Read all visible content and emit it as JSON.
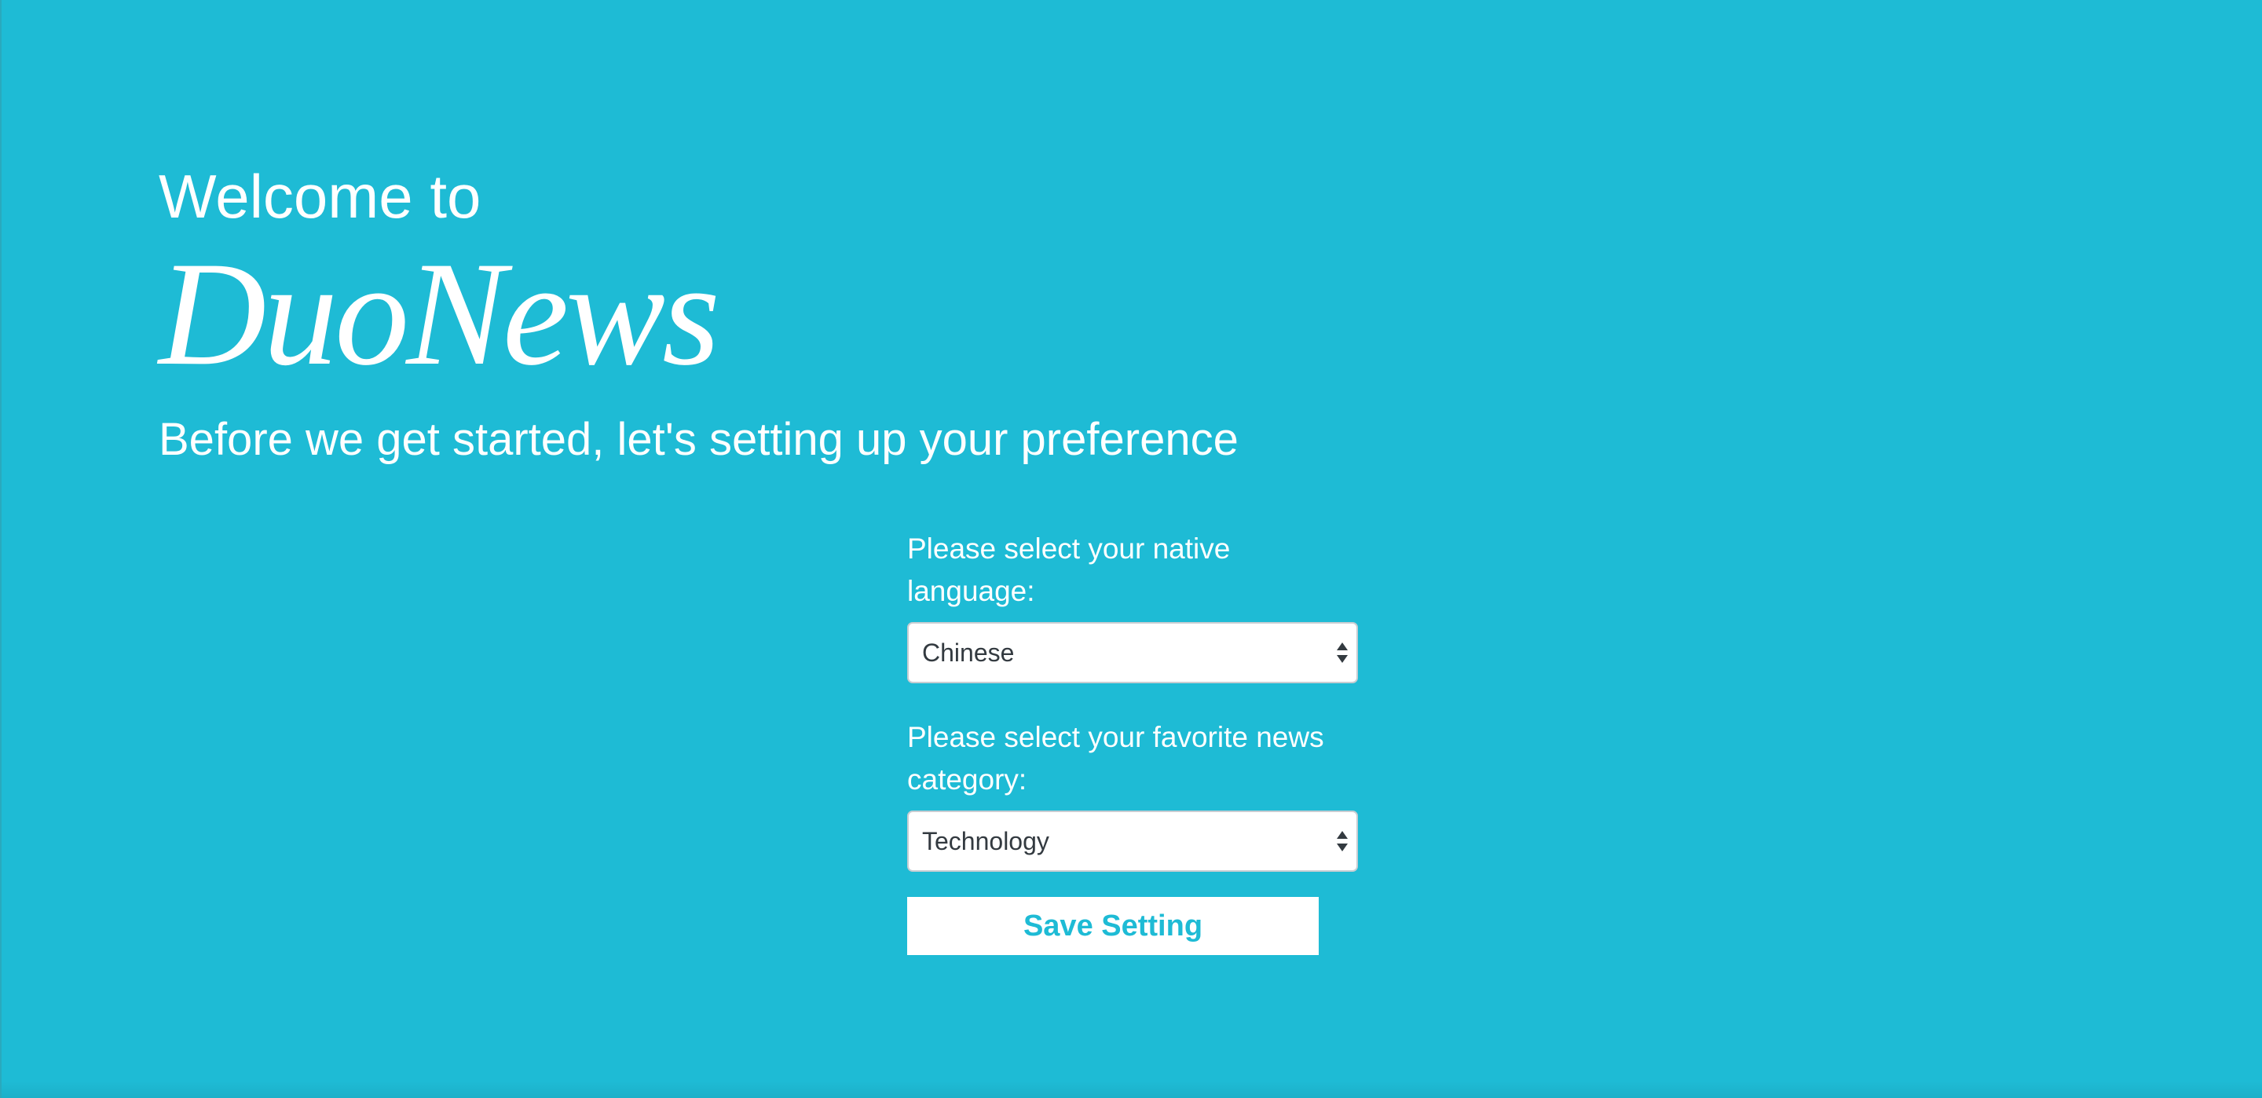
{
  "header": {
    "welcome": "Welcome to",
    "brand": "DuoNews",
    "subtitle": "Before we get started, let's setting up your preference"
  },
  "form": {
    "language": {
      "label": "Please select your native language:",
      "selected": "Chinese"
    },
    "category": {
      "label": "Please select your favorite news category:",
      "selected": "Technology"
    },
    "save_label": "Save Setting"
  },
  "colors": {
    "background": "#1ebbd5",
    "text": "#ffffff",
    "button_text": "#1ebbd5"
  }
}
